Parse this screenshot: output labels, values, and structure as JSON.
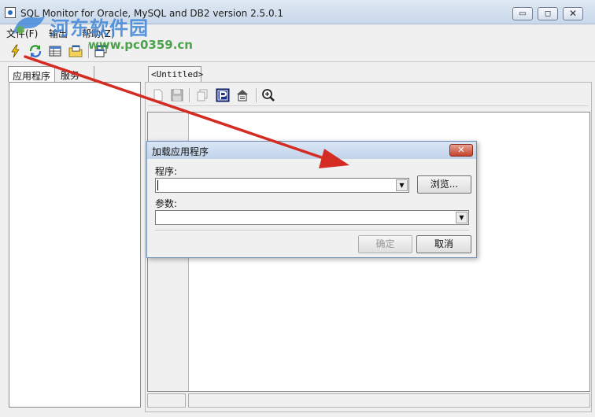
{
  "window": {
    "title": "SQL Monitor for Oracle, MySQL and DB2 version 2.5.0.1",
    "controls": {
      "minimize": "▭",
      "maximize": "◻",
      "close": "✕"
    }
  },
  "watermark": {
    "brand": "河东软件园",
    "url": "www.pc0359.cn"
  },
  "menu": {
    "items": [
      "文件(F)",
      "输出",
      "帮助(Z)"
    ]
  },
  "left_panel": {
    "tabs": [
      "应用程序",
      "服务"
    ],
    "active_tab": 0
  },
  "document": {
    "tab_label": "<Untitled>"
  },
  "dialog": {
    "title": "加载应用程序",
    "program_label": "程序:",
    "program_value": "",
    "browse_button": "浏览...",
    "params_label": "参数:",
    "params_value": "",
    "ok_button": "确定",
    "cancel_button": "取消",
    "close_glyph": "✕"
  },
  "icons": {
    "toolbar": [
      "lightning-icon",
      "refresh-icon",
      "table-icon",
      "folder-icon",
      "copy-window-icon"
    ],
    "sub_toolbar": [
      "new-document-icon",
      "save-icon",
      "copy-icon",
      "p-icon",
      "export-icon",
      "zoom-icon"
    ]
  },
  "colors": {
    "arrow": "#d42b22",
    "watermark_blue": "#3f86d8",
    "watermark_green": "#3a9a3a"
  }
}
